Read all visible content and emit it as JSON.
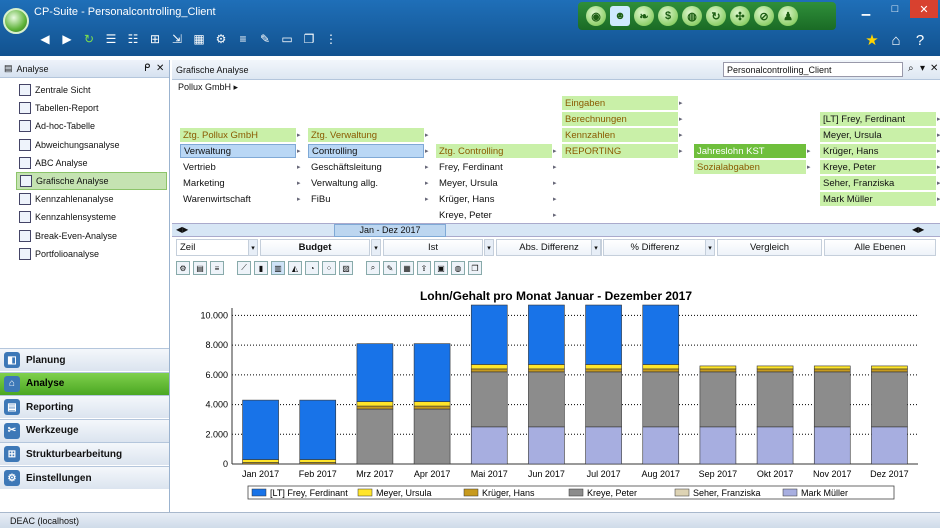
{
  "window": {
    "title": "CP-Suite - Personalcontrolling_Client"
  },
  "modules": [
    {
      "name": "dashboard-icon",
      "glyph": "◉"
    },
    {
      "name": "people-icon",
      "glyph": "☻"
    },
    {
      "name": "leaf-icon",
      "glyph": "❧"
    },
    {
      "name": "money-icon",
      "glyph": "$"
    },
    {
      "name": "globe-icon",
      "glyph": "◍"
    },
    {
      "name": "refresh-icon",
      "glyph": "↻"
    },
    {
      "name": "puzzle-icon",
      "glyph": "✣"
    },
    {
      "name": "compass-icon",
      "glyph": "⊘"
    },
    {
      "name": "user-icon",
      "glyph": "♟"
    }
  ],
  "left": {
    "header": "Analyse",
    "items": [
      {
        "label": "Zentrale Sicht"
      },
      {
        "label": "Tabellen-Report"
      },
      {
        "label": "Ad-hoc-Tabelle"
      },
      {
        "label": "Abweichungsanalyse"
      },
      {
        "label": "ABC Analyse"
      },
      {
        "label": "Grafische Analyse"
      },
      {
        "label": "Kennzahlenanalyse"
      },
      {
        "label": "Kennzahlensysteme"
      },
      {
        "label": "Break-Even-Analyse"
      },
      {
        "label": "Portfolioanalyse"
      }
    ],
    "nav": [
      "Planung",
      "Analyse",
      "Reporting",
      "Werkzeuge",
      "Strukturbearbeitung",
      "Einstellungen"
    ]
  },
  "main": {
    "header": "Grafische Analyse",
    "client": "Personalcontrolling_Client",
    "breadcrumb": "Pollux GmbH",
    "col1": [
      "Ztg. Pollux GmbH",
      "Verwaltung",
      "Vertrieb",
      "Marketing",
      "Warenwirtschaft"
    ],
    "col2": [
      "Ztg. Verwaltung",
      "Controlling",
      "Geschäftsleitung",
      "Verwaltung allg.",
      "FiBu"
    ],
    "col3": [
      "Ztg. Controlling",
      "Frey, Ferdinant",
      "Meyer, Ursula",
      "Krüger, Hans",
      "Kreye, Peter"
    ],
    "col4": [
      "Eingaben",
      "Berechnungen",
      "Kennzahlen",
      "REPORTING"
    ],
    "col5": [
      "Jahreslohn KST",
      "Sozialabgaben"
    ],
    "col6": [
      "[LT] Frey, Ferdinant",
      "Meyer, Ursula",
      "Krüger, Hans",
      "Kreye, Peter",
      "Seher, Franziska",
      "Mark Müller"
    ],
    "timeline": "Jan - Dez 2017",
    "filters": {
      "zeile": "Zeil",
      "budget": "Budget",
      "ist": "Ist",
      "absdiff": "Abs. Differenz",
      "pctdiff": "% Differenz",
      "vergleich": "Vergleich",
      "ebenen": "Alle Ebenen"
    }
  },
  "status": {
    "text": "DEAC (localhost)"
  },
  "chart_data": {
    "type": "bar",
    "stacked": true,
    "title": "Lohn/Gehalt pro Monat Januar - Dezember 2017",
    "categories": [
      "Jan 2017",
      "Feb 2017",
      "Mrz 2017",
      "Apr 2017",
      "Mai 2017",
      "Jun 2017",
      "Jul 2017",
      "Aug 2017",
      "Sep 2017",
      "Okt 2017",
      "Nov 2017",
      "Dez 2017"
    ],
    "ylim": [
      0,
      10500
    ],
    "yticks": [
      "0",
      "2.000",
      "4.000",
      "6.000",
      "8.000",
      "10.000"
    ],
    "ytick_values": [
      0,
      2000,
      4000,
      6000,
      8000,
      10000
    ],
    "grid": true,
    "legend_position": "bottom",
    "series": [
      {
        "name": "Mark Müller",
        "color": "#a7aee0",
        "values": [
          0,
          0,
          0,
          0,
          2500,
          2500,
          2500,
          2500,
          2500,
          2500,
          2500,
          2500
        ]
      },
      {
        "name": "Seher, Franziska",
        "color": "#ddd3b4",
        "values": [
          0,
          0,
          0,
          0,
          0,
          0,
          0,
          0,
          0,
          0,
          0,
          0
        ]
      },
      {
        "name": "Kreye, Peter",
        "color": "#8c8c8c",
        "values": [
          0,
          0,
          3700,
          3700,
          3700,
          3700,
          3700,
          3700,
          3700,
          3700,
          3700,
          3700
        ]
      },
      {
        "name": "Krüger, Hans",
        "color": "#c79a1e",
        "values": [
          100,
          100,
          200,
          200,
          200,
          200,
          200,
          200,
          200,
          200,
          200,
          200
        ]
      },
      {
        "name": "Meyer, Ursula",
        "color": "#ffe52a",
        "values": [
          200,
          200,
          300,
          300,
          300,
          300,
          300,
          300,
          200,
          200,
          200,
          200
        ]
      },
      {
        "name": "[LT] Frey, Ferdinant",
        "color": "#1873e8",
        "values": [
          4000,
          4000,
          3900,
          3900,
          4000,
          4000,
          4000,
          4000,
          0,
          0,
          0,
          0
        ]
      }
    ],
    "legend_order": [
      "[LT] Frey, Ferdinant",
      "Meyer, Ursula",
      "Krüger, Hans",
      "Kreye, Peter",
      "Seher, Franziska",
      "Mark Müller"
    ]
  }
}
